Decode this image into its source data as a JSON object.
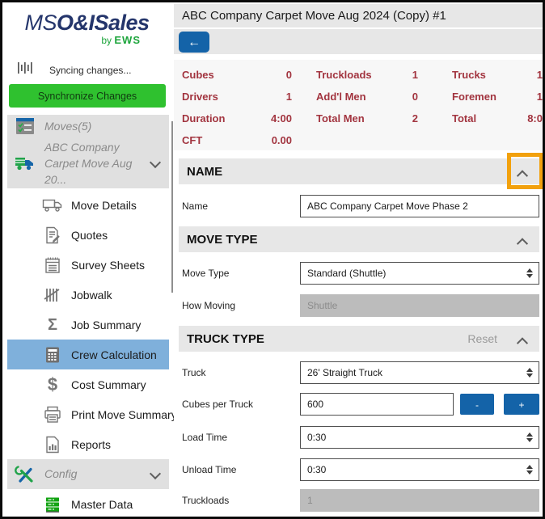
{
  "colors": {
    "accent_blue": "#1463a8",
    "sync_green": "#2fc12f",
    "stats_maroon": "#a2343f",
    "active_item_blue": "#7fb0db",
    "annotation_orange": "#f2a10d",
    "brand_navy": "#24356b",
    "brand_green": "#1da53c",
    "section_header_gray": "#e7e7e7",
    "disabled_gray": "#bcbcbc"
  },
  "icons": {
    "sigma": "Σ",
    "dollar": "$",
    "back_arrow": "←"
  },
  "logo": {
    "ms": "MS",
    "suffix": "O&ISales",
    "by": "by",
    "brand": "EWS"
  },
  "sidebar": {
    "sync_status": "Syncing changes...",
    "sync_button": "Synchronize Changes",
    "items": [
      {
        "label": "Moves(5)"
      },
      {
        "label": "ABC Company Carpet Move Aug 20..."
      },
      {
        "label": "Move Details"
      },
      {
        "label": "Quotes"
      },
      {
        "label": "Survey Sheets"
      },
      {
        "label": "Jobwalk"
      },
      {
        "label": "Job Summary"
      },
      {
        "label": "Crew Calculation"
      },
      {
        "label": "Cost Summary"
      },
      {
        "label": "Print Move Summary"
      },
      {
        "label": "Reports"
      },
      {
        "label": "Config"
      },
      {
        "label": "Master Data"
      }
    ]
  },
  "header": {
    "title": "ABC Company Carpet Move Aug 2024 (Copy) #1"
  },
  "stats": [
    {
      "label": "Cubes",
      "value": "0"
    },
    {
      "label": "Truckloads",
      "value": "1"
    },
    {
      "label": "Trucks",
      "value": "1"
    },
    {
      "label": "Drivers",
      "value": "1"
    },
    {
      "label": "Add'l Men",
      "value": "0"
    },
    {
      "label": "Foremen",
      "value": "1"
    },
    {
      "label": "Duration",
      "value": "4:00"
    },
    {
      "label": "Total Men",
      "value": "2"
    },
    {
      "label": "Total",
      "value": "8:0"
    },
    {
      "label": "CFT",
      "value": "0.00"
    }
  ],
  "sections": {
    "name": {
      "title": "NAME",
      "fields": {
        "name": {
          "label": "Name",
          "value": "ABC Company Carpet Move Phase 2"
        }
      }
    },
    "move_type": {
      "title": "MOVE TYPE",
      "fields": {
        "move_type": {
          "label": "Move Type",
          "value": "Standard (Shuttle)"
        },
        "how_moving": {
          "label": "How Moving",
          "value": "Shuttle"
        }
      }
    },
    "truck_type": {
      "title": "TRUCK TYPE",
      "reset": "Reset",
      "fields": {
        "truck": {
          "label": "Truck",
          "value": "26' Straight Truck"
        },
        "cubes_per_truck": {
          "label": "Cubes per Truck",
          "value": "600",
          "minus": "-",
          "plus": "+"
        },
        "load_time": {
          "label": "Load Time",
          "value": "0:30"
        },
        "unload_time": {
          "label": "Unload Time",
          "value": "0:30"
        },
        "truckloads": {
          "label": "Truckloads",
          "value": "1"
        }
      }
    }
  }
}
